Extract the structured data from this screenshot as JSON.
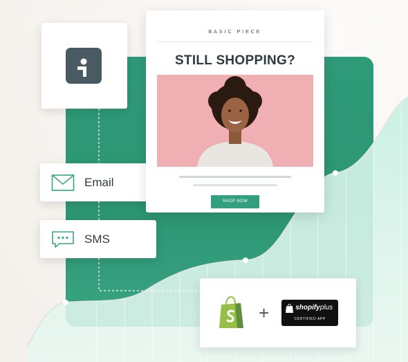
{
  "email_template": {
    "brand": "BASIC PIECE",
    "headline": "STILL SHOPPING?",
    "cta_label": "SHOP NOW"
  },
  "channels": {
    "email_label": "Email",
    "sms_label": "SMS"
  },
  "integration": {
    "plus_sign": "+",
    "badge_brand": "shopify",
    "badge_brand_suffix": "plus",
    "badge_caption": "CERTIFIED APP"
  },
  "icons": {
    "logo": "klaviyo-style-logo-icon",
    "email": "envelope-icon",
    "sms": "chat-bubble-icon",
    "shopify": "shopify-bag-icon"
  },
  "colors": {
    "accent_green": "#2f9a78",
    "button_green": "#32a07f",
    "hero_pink": "#f0b0b3",
    "logo_gray": "#4a5a63",
    "shopify_green": "#95bf47",
    "badge_black": "#111111"
  }
}
